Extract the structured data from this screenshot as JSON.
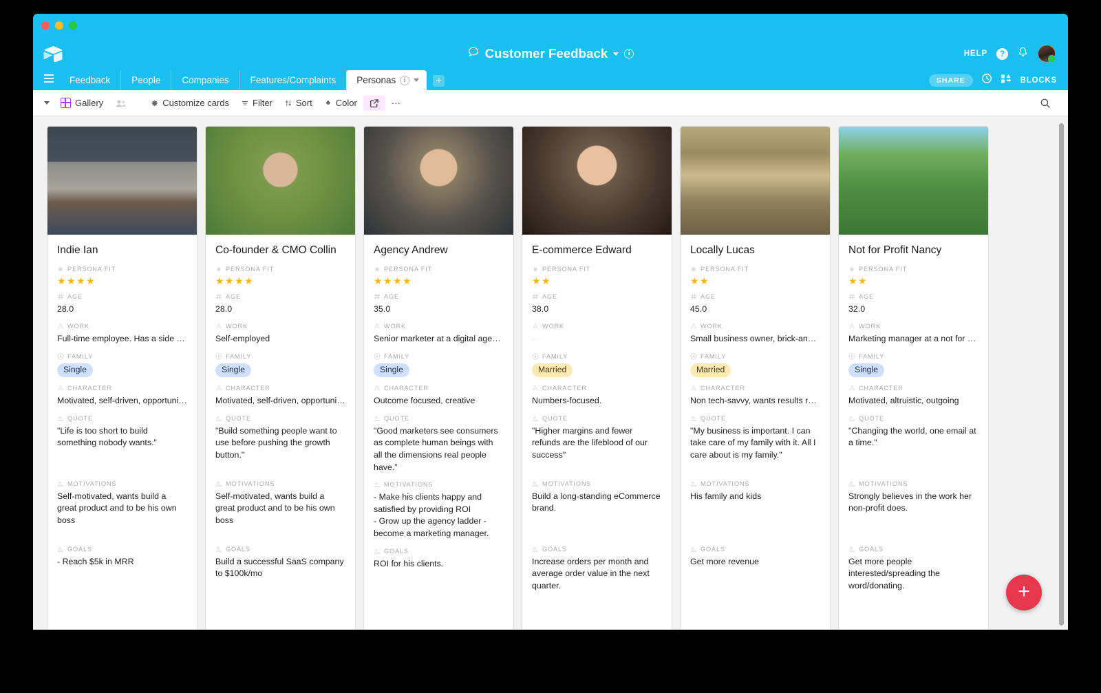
{
  "window": {
    "traffic_lights": [
      "close",
      "minimize",
      "maximize"
    ]
  },
  "header": {
    "doc_title": "Customer Feedback",
    "doc_icon": "speech-bubble-icon",
    "help_label": "HELP",
    "help_icon": "question-mark-icon",
    "notifications_icon": "bell-icon",
    "avatar_icon": "user-avatar",
    "brand_color": "#18bfef"
  },
  "tabs": {
    "menu_icon": "hamburger-menu-icon",
    "items": [
      {
        "label": "Feedback",
        "active": false
      },
      {
        "label": "People",
        "active": false
      },
      {
        "label": "Companies",
        "active": false
      },
      {
        "label": "Features/Complaints",
        "active": false
      },
      {
        "label": "Personas",
        "active": true
      }
    ],
    "add_label": "+",
    "share_label": "SHARE",
    "history_icon": "clock-history-icon",
    "blocks_label": "BLOCKS",
    "blocks_icon": "blocks-icon"
  },
  "toolbar": {
    "view_name": "Gallery",
    "collaborators_icon": "collaborators-icon",
    "customize_label": "Customize cards",
    "filter_label": "Filter",
    "sort_label": "Sort",
    "color_label": "Color",
    "share_view_icon": "share-view-icon",
    "more_label": "···",
    "search_icon": "search-icon"
  },
  "fields": {
    "persona_fit": "PERSONA FIT",
    "age": "AGE",
    "work": "WORK",
    "family": "FAMILY",
    "character": "CHARACTER",
    "quote": "QUOTE",
    "motivations": "MOTIVATIONS",
    "goals": "GOALS"
  },
  "cards": [
    {
      "name": "Indie Ian",
      "stars": 4,
      "age": "28.0",
      "work": "Full-time employee. Has a side h…",
      "family": "Single",
      "family_type": "single",
      "character": "Motivated, self-driven, opportuni…",
      "quote": "\"Life is too short to build something nobody wants.\"",
      "motivations": "Self-motivated, wants build a great product and to be his own boss",
      "goals": "- Reach $5k in MRR",
      "photo": "photo-skier-man"
    },
    {
      "name": "Co-founder & CMO Collin",
      "stars": 4,
      "age": "28.0",
      "work": "Self-employed",
      "family": "Single",
      "family_type": "single",
      "character": "Motivated, self-driven, opportuni…",
      "quote": "\"Build something people want to use before pushing the growth button.\"",
      "motivations": "Self-motivated, wants build a great product and to be his own boss",
      "goals": "Build a successful SaaS company to $100k/mo",
      "photo": "photo-glasses-man-park"
    },
    {
      "name": "Agency Andrew",
      "stars": 4,
      "age": "35.0",
      "work": "Senior marketer at a digital agency",
      "family": "Single",
      "family_type": "single",
      "character": "Outcome focused, creative",
      "quote": " \"Good marketers see consumers as complete human beings with all the dimensions real people have.”",
      "motivations": "- Make his clients happy and satisfied by providing ROI\n- Grow up the agency ladder - become a marketing manager.",
      "goals": "ROI for his clients.",
      "photo": "photo-suited-man"
    },
    {
      "name": "E-commerce Edward",
      "stars": 2,
      "age": "38.0",
      "work": "—",
      "work_faint": true,
      "family": "Married",
      "family_type": "married",
      "character": "Numbers-focused.",
      "quote": "\"Higher margins and fewer refunds are the lifeblood of our success\"",
      "motivations": "Build a long-standing eCommerce brand.",
      "goals": "Increase orders per month and average order value in the next quarter.",
      "photo": "photo-sweater-man"
    },
    {
      "name": "Locally Lucas",
      "stars": 2,
      "age": "45.0",
      "work": "Small business owner, brick-and…",
      "family": "Married",
      "family_type": "married",
      "character": "Non tech-savvy, wants results re…",
      "quote": "\"My business is important. I can take care of my family with it. All I care about is my family.\"",
      "motivations": "His family and kids",
      "goals": "Get more revenue",
      "photo": "photo-cowboy-grocer"
    },
    {
      "name": "Not for Profit Nancy",
      "stars": 2,
      "age": "32.0",
      "work": "Marketing manager at a not for p…",
      "family": "Single",
      "family_type": "single",
      "character": "Motivated, altruistic, outgoing",
      "quote": "\"Changing the world, one email at a time.\"",
      "motivations": "Strongly believes in the work her non-profit does.",
      "goals": "Get more people interested/spreading the word/donating.",
      "photo": "photo-woman-hedge"
    }
  ],
  "fab": {
    "label": "+",
    "color": "#e8384f"
  }
}
